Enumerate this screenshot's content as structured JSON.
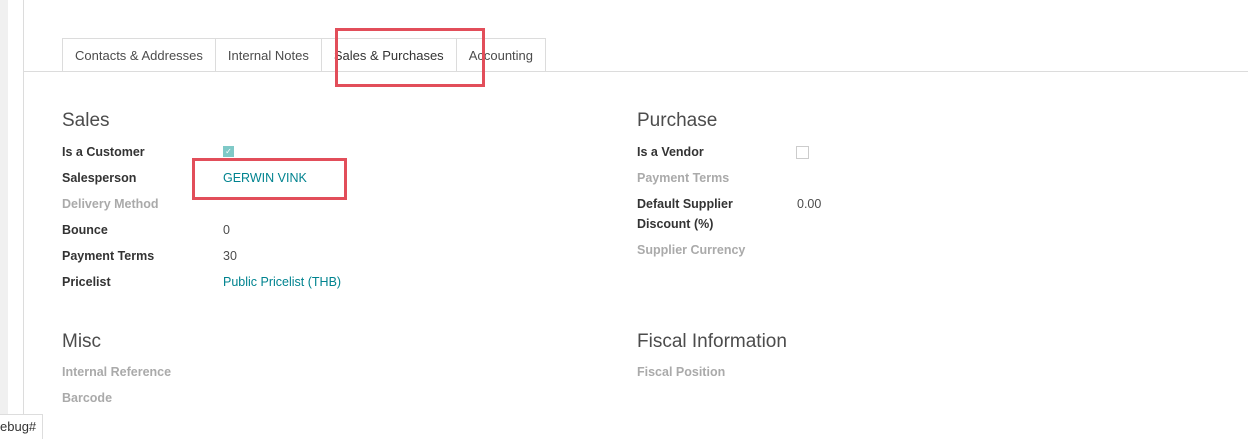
{
  "tabs": [
    {
      "label": "Contacts & Addresses"
    },
    {
      "label": "Internal Notes"
    },
    {
      "label": "Sales & Purchases"
    },
    {
      "label": "Accounting"
    }
  ],
  "sales": {
    "title": "Sales",
    "is_customer_label": "Is a Customer",
    "is_customer_checked": true,
    "salesperson_label": "Salesperson",
    "salesperson_value": "GERWIN VINK",
    "delivery_method_label": "Delivery Method",
    "bounce_label": "Bounce",
    "bounce_value": "0",
    "payment_terms_label": "Payment Terms",
    "payment_terms_value": "30",
    "pricelist_label": "Pricelist",
    "pricelist_value": "Public Pricelist (THB)"
  },
  "purchase": {
    "title": "Purchase",
    "is_vendor_label": "Is a Vendor",
    "is_vendor_checked": false,
    "payment_terms_label": "Payment Terms",
    "default_supplier_discount_label_1": "Default Supplier",
    "default_supplier_discount_label_2": "Discount (%)",
    "default_supplier_discount_value": "0.00",
    "supplier_currency_label": "Supplier Currency"
  },
  "misc": {
    "title": "Misc",
    "internal_reference_label": "Internal Reference",
    "barcode_label": "Barcode"
  },
  "fiscal": {
    "title": "Fiscal Information",
    "fiscal_position_label": "Fiscal Position"
  },
  "status_bar": {
    "text": "ebug#"
  },
  "colors": {
    "link": "#00838f",
    "highlight": "#e24e5a",
    "checkbox_checked": "#7fc9c7"
  }
}
